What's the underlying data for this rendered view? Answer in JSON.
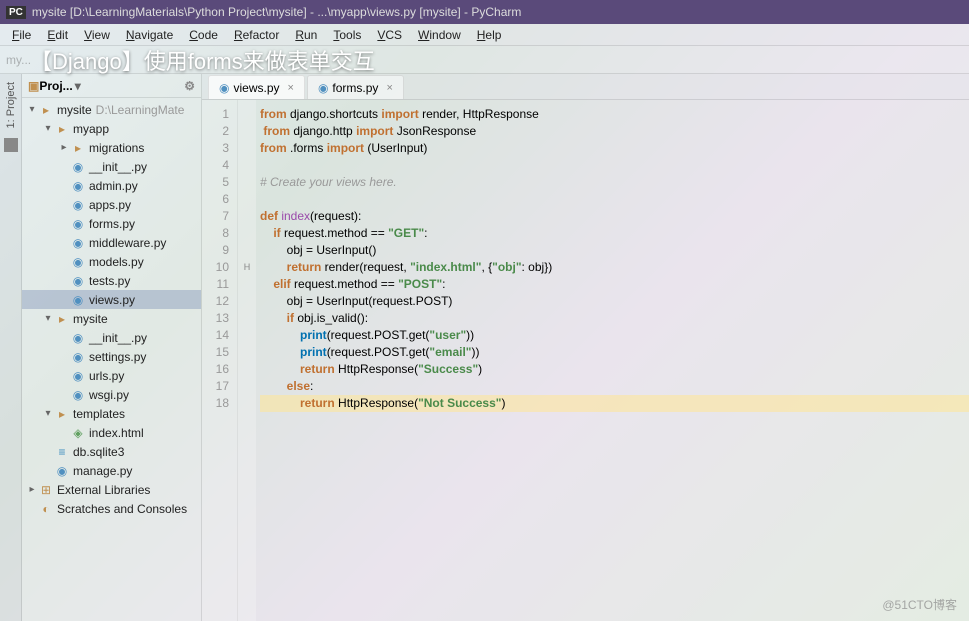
{
  "window_title": "mysite [D:\\LearningMaterials\\Python Project\\mysite] - ...\\myapp\\views.py [mysite] - PyCharm",
  "overlay": "【Django】使用forms来做表单交互",
  "menu": [
    "File",
    "Edit",
    "View",
    "Navigate",
    "Code",
    "Refactor",
    "Run",
    "Tools",
    "VCS",
    "Window",
    "Help"
  ],
  "breadcrumb": "my...",
  "left_vert": {
    "project": "1: Project"
  },
  "sidebar": {
    "title": "Proj...",
    "tree": [
      {
        "d": 0,
        "chev": "v",
        "icon": "folder",
        "label": "mysite",
        "suffix": "D:\\LearningMate"
      },
      {
        "d": 1,
        "chev": "v",
        "icon": "folder",
        "label": "myapp"
      },
      {
        "d": 2,
        "chev": ">",
        "icon": "folder",
        "label": "migrations"
      },
      {
        "d": 2,
        "icon": "py",
        "label": "__init__.py"
      },
      {
        "d": 2,
        "icon": "py",
        "label": "admin.py"
      },
      {
        "d": 2,
        "icon": "py",
        "label": "apps.py"
      },
      {
        "d": 2,
        "icon": "py",
        "label": "forms.py"
      },
      {
        "d": 2,
        "icon": "py",
        "label": "middleware.py"
      },
      {
        "d": 2,
        "icon": "py",
        "label": "models.py"
      },
      {
        "d": 2,
        "icon": "py",
        "label": "tests.py"
      },
      {
        "d": 2,
        "icon": "py",
        "label": "views.py",
        "selected": true
      },
      {
        "d": 1,
        "chev": "v",
        "icon": "folder",
        "label": "mysite"
      },
      {
        "d": 2,
        "icon": "py",
        "label": "__init__.py"
      },
      {
        "d": 2,
        "icon": "py",
        "label": "settings.py"
      },
      {
        "d": 2,
        "icon": "py",
        "label": "urls.py"
      },
      {
        "d": 2,
        "icon": "py",
        "label": "wsgi.py"
      },
      {
        "d": 1,
        "chev": "v",
        "icon": "folder",
        "label": "templates"
      },
      {
        "d": 2,
        "icon": "html",
        "label": "index.html"
      },
      {
        "d": 1,
        "icon": "db",
        "label": "db.sqlite3"
      },
      {
        "d": 1,
        "icon": "py",
        "label": "manage.py"
      },
      {
        "d": 0,
        "chev": ">",
        "icon": "lib",
        "label": "External Libraries"
      },
      {
        "d": 0,
        "icon": "scratch",
        "label": "Scratches and Consoles"
      }
    ]
  },
  "tabs": [
    {
      "icon": "py",
      "label": "views.py",
      "active": true
    },
    {
      "icon": "py",
      "label": "forms.py"
    }
  ],
  "code": {
    "lines": [
      {
        "n": 1,
        "html": "<span class='kw'>from</span> django.shortcuts <span class='kw'>import</span> render, HttpResponse"
      },
      {
        "n": 2,
        "html": " <span class='kw'>from</span> django.http <span class='kw'>import</span> JsonResponse"
      },
      {
        "n": 3,
        "html": "<span class='kw'>from</span> .forms <span class='kw'>import</span> (UserInput)"
      },
      {
        "n": 4,
        "html": ""
      },
      {
        "n": 5,
        "html": "<span class='cmt'># Create your views here.</span>"
      },
      {
        "n": 6,
        "html": ""
      },
      {
        "n": 7,
        "html": "<span class='kw'>def</span> <span class='fn'>index</span>(request):"
      },
      {
        "n": 8,
        "html": "    <span class='kw'>if</span> request.method == <span class='str'>\"GET\"</span>:"
      },
      {
        "n": 9,
        "html": "        obj = UserInput()"
      },
      {
        "n": 10,
        "mark": "H",
        "html": "        <span class='kw'>return</span> render(request, <span class='str'>\"index.html\"</span>, {<span class='str'>\"obj\"</span>: obj})"
      },
      {
        "n": 11,
        "html": "    <span class='kw'>elif</span> request.method == <span class='str'>\"POST\"</span>:"
      },
      {
        "n": 12,
        "html": "        obj = UserInput(request.POST)"
      },
      {
        "n": 13,
        "html": "        <span class='kw'>if</span> obj.is_valid():"
      },
      {
        "n": 14,
        "html": "            <span class='kw2'>print</span>(request.POST.get(<span class='str'>\"user\"</span>))"
      },
      {
        "n": 15,
        "html": "            <span class='kw2'>print</span>(request.POST.get(<span class='str'>\"email\"</span>))"
      },
      {
        "n": 16,
        "html": "            <span class='kw'>return</span> HttpResponse(<span class='str'>\"Success\"</span>)"
      },
      {
        "n": 17,
        "html": "        <span class='kw'>else</span>:"
      },
      {
        "n": 18,
        "hl": true,
        "html": "            <span class='kw'>return</span> HttpResponse(<span class='str'>\"Not Success\"</span>)"
      }
    ]
  },
  "watermark": "@51CTO博客"
}
